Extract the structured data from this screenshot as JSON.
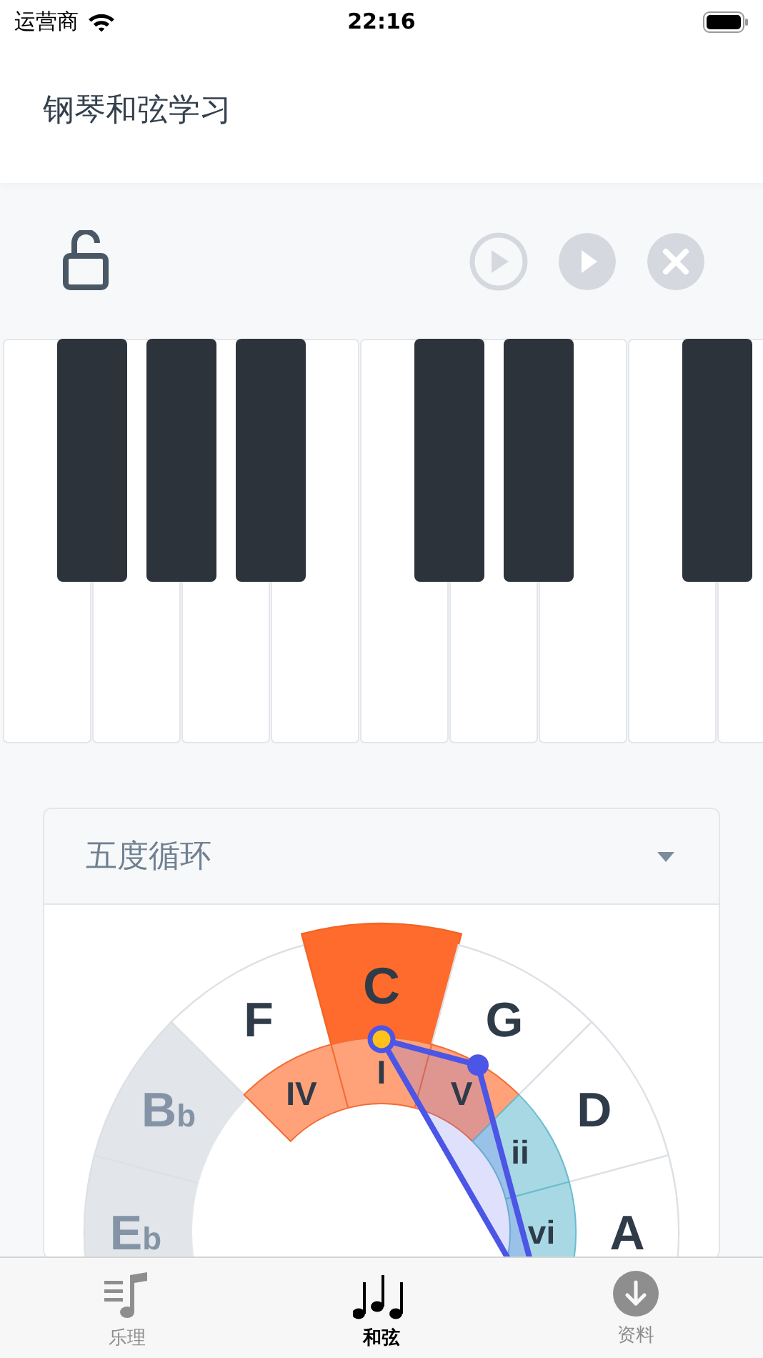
{
  "status_bar": {
    "carrier": "运营商",
    "time": "22:16"
  },
  "header": {
    "title": "钢琴和弦学习"
  },
  "toolbar": {
    "locked": false
  },
  "circle_panel": {
    "title": "五度循环",
    "keys": [
      {
        "note": "E",
        "accidental": "b",
        "selected": false,
        "disabled": true
      },
      {
        "note": "B",
        "accidental": "b",
        "selected": false,
        "disabled": true
      },
      {
        "note": "F",
        "selected": false,
        "disabled": false
      },
      {
        "note": "C",
        "selected": true,
        "disabled": false
      },
      {
        "note": "G",
        "selected": false,
        "disabled": false
      },
      {
        "note": "D",
        "selected": false,
        "disabled": false
      },
      {
        "note": "A",
        "selected": false,
        "disabled": false
      }
    ],
    "degrees": [
      {
        "label": "IV",
        "kind": "major"
      },
      {
        "label": "I",
        "kind": "major"
      },
      {
        "label": "V",
        "kind": "major"
      },
      {
        "label": "ii",
        "kind": "minor"
      },
      {
        "label": "vi",
        "kind": "minor"
      }
    ]
  },
  "tabs": [
    {
      "label": "乐理",
      "selected": false
    },
    {
      "label": "和弦",
      "selected": true
    },
    {
      "label": "资料",
      "selected": false
    }
  ]
}
